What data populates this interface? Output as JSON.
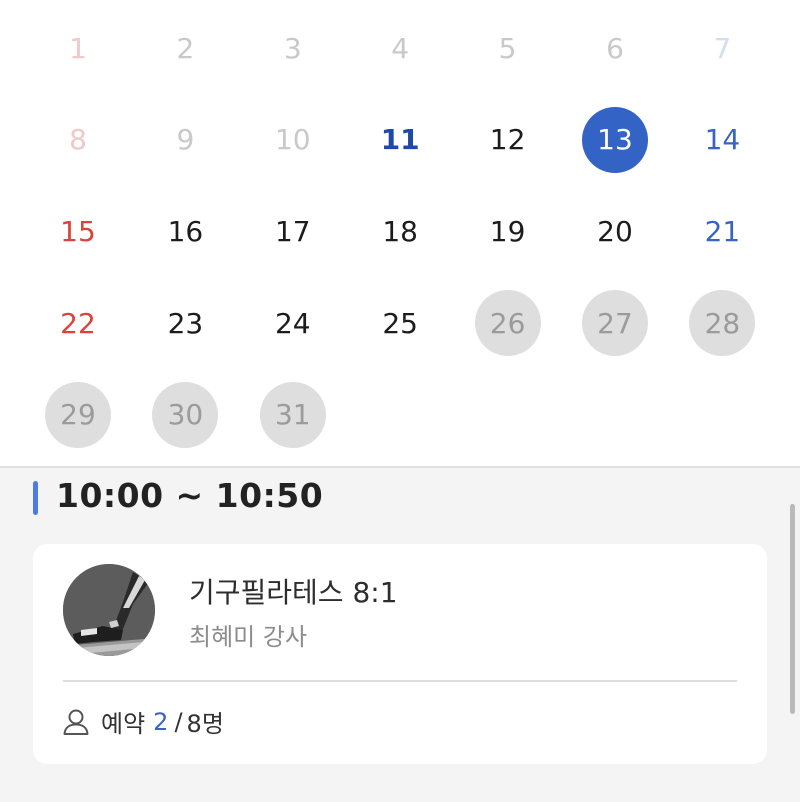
{
  "calendar": {
    "days": [
      {
        "label": "1",
        "state": "faded sun"
      },
      {
        "label": "2",
        "state": "faded"
      },
      {
        "label": "3",
        "state": "faded"
      },
      {
        "label": "4",
        "state": "faded"
      },
      {
        "label": "5",
        "state": "faded"
      },
      {
        "label": "6",
        "state": "faded"
      },
      {
        "label": "7",
        "state": "faded sat"
      },
      {
        "label": "8",
        "state": "faded sun"
      },
      {
        "label": "9",
        "state": "faded"
      },
      {
        "label": "10",
        "state": "faded"
      },
      {
        "label": "11",
        "state": "today"
      },
      {
        "label": "12",
        "state": ""
      },
      {
        "label": "13",
        "state": "selected"
      },
      {
        "label": "14",
        "state": "sat"
      },
      {
        "label": "15",
        "state": "sun"
      },
      {
        "label": "16",
        "state": ""
      },
      {
        "label": "17",
        "state": ""
      },
      {
        "label": "18",
        "state": ""
      },
      {
        "label": "19",
        "state": ""
      },
      {
        "label": "20",
        "state": ""
      },
      {
        "label": "21",
        "state": "sat"
      },
      {
        "label": "22",
        "state": "sun"
      },
      {
        "label": "23",
        "state": ""
      },
      {
        "label": "24",
        "state": ""
      },
      {
        "label": "25",
        "state": ""
      },
      {
        "label": "26",
        "state": "disabled"
      },
      {
        "label": "27",
        "state": "disabled"
      },
      {
        "label": "28",
        "state": "disabled"
      },
      {
        "label": "29",
        "state": "disabled"
      },
      {
        "label": "30",
        "state": "disabled"
      },
      {
        "label": "31",
        "state": "disabled"
      }
    ]
  },
  "schedule": {
    "time_range": "10:00 ~ 10:50",
    "accent_color": "#4d7be6",
    "card": {
      "class_name": "기구필라테스 8:1",
      "instructor": "최혜미 강사",
      "booking_label": "예약",
      "booked": "2",
      "separator": "/",
      "capacity": "8명",
      "icon": "person-icon"
    }
  }
}
